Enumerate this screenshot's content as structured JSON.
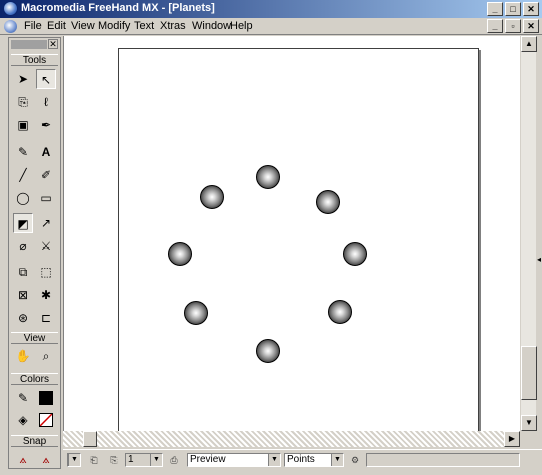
{
  "window": {
    "title": "Macromedia FreeHand MX - [Planets]"
  },
  "menu": {
    "items": [
      "File",
      "Edit",
      "View",
      "Modify",
      "Text",
      "Xtras",
      "Window",
      "Help"
    ]
  },
  "tools_panel": {
    "title": "Tools",
    "view_label": "View",
    "colors_label": "Colors",
    "snap_label": "Snap",
    "stroke_color": "#000000",
    "fill_color": "#ffffff"
  },
  "canvas": {
    "planets": [
      {
        "name": "planet-1"
      },
      {
        "name": "planet-2"
      },
      {
        "name": "planet-3"
      },
      {
        "name": "planet-4"
      },
      {
        "name": "planet-5"
      },
      {
        "name": "planet-6"
      },
      {
        "name": "planet-7"
      },
      {
        "name": "planet-8"
      }
    ]
  },
  "status": {
    "page_number": "1",
    "view_mode": "Preview",
    "units": "Points"
  },
  "colors": {
    "title_start": "#0a246a",
    "title_end": "#a6caf0",
    "chrome": "#d4d0c8"
  }
}
